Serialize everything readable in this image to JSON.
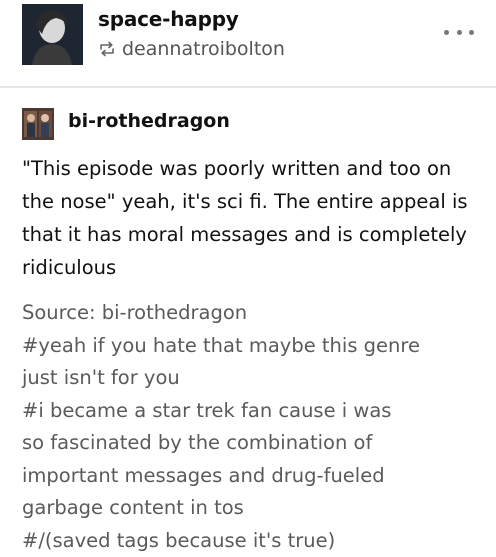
{
  "header": {
    "blog_name": "space-happy",
    "reblogged_from": "deannatroibolton",
    "more_icon": "ellipsis-icon",
    "reblog_icon": "reblog-icon"
  },
  "source_post": {
    "author": "bi-rothedragon",
    "body": "\"This episode was poorly written and too on the nose\" yeah, it's sci fi. The entire appeal is that it has moral messages and is completely ridiculous"
  },
  "footer": {
    "source_line": "Source: bi-rothedragon",
    "tag_lines": [
      "#yeah if you hate that maybe this genre",
      "just isn't for you",
      "#i became a star trek fan cause i was",
      "so fascinated by the combination of",
      "important messages and drug-fueled",
      "garbage content in tos",
      "#/(saved tags because it's true)"
    ]
  },
  "colors": {
    "text": "#111111",
    "muted": "#5a5a5a",
    "divider": "#e6e6e6"
  }
}
